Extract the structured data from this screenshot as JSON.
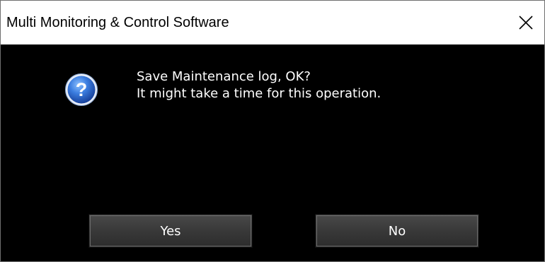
{
  "window": {
    "title": "Multi Monitoring & Control Software"
  },
  "dialog": {
    "icon": "question-icon",
    "message_line1": "Save Maintenance log, OK?",
    "message_line2": "It might take a time for this operation.",
    "yes_label": "Yes",
    "no_label": "No"
  },
  "colors": {
    "titlebar_bg": "#ffffff",
    "content_bg": "#000000",
    "button_bg": "#3a3a3a",
    "icon_blue": "#2a64c8"
  }
}
